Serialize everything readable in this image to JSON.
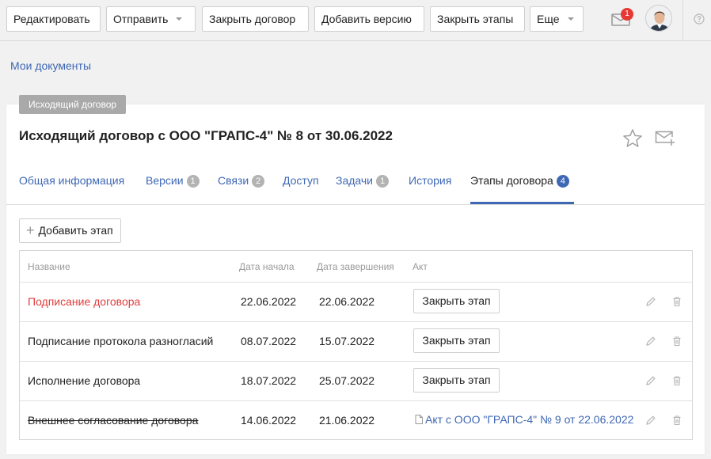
{
  "toolbar": {
    "edit_label": "Редактировать",
    "send_label": "Отправить",
    "close_contract_label": "Закрыть договор",
    "add_version_label": "Добавить версию",
    "close_stages_label": "Закрыть этапы",
    "more_label": "Еще",
    "notifications_count": "1"
  },
  "breadcrumb": {
    "label": "Мои документы"
  },
  "document": {
    "type_label": "Исходящий договор",
    "title": "Исходящий договор с ООО \"ГРАПС-4\" № 8 от 30.06.2022"
  },
  "tabs": [
    {
      "label": "Общая информация",
      "count": ""
    },
    {
      "label": "Версии",
      "count": "1"
    },
    {
      "label": "Связи",
      "count": "2"
    },
    {
      "label": "Доступ",
      "count": ""
    },
    {
      "label": "Задачи",
      "count": "1"
    },
    {
      "label": "История",
      "count": ""
    },
    {
      "label": "Этапы договора",
      "count": "4",
      "active": true
    }
  ],
  "stages": {
    "add_label": "Добавить этап",
    "columns": [
      "Название",
      "Дата начала",
      "Дата завершения",
      "Акт"
    ],
    "rows": [
      {
        "name": "Подписание договора",
        "start": "22.06.2022",
        "end": "22.06.2022",
        "act_button": "Закрыть этап",
        "status": "overdue"
      },
      {
        "name": "Подписание протокола разногласий",
        "start": "08.07.2022",
        "end": "15.07.2022",
        "act_button": "Закрыть этап",
        "status": "open"
      },
      {
        "name": "Исполнение договора",
        "start": "18.07.2022",
        "end": "25.07.2022",
        "act_button": "Закрыть этап",
        "status": "open"
      },
      {
        "name": "Внешнее согласование договора",
        "start": "14.06.2022",
        "end": "21.06.2022",
        "act_link": "Акт с ООО \"ГРАПС-4\" № 9 от 22.06.2022",
        "status": "closed"
      }
    ]
  },
  "colors": {
    "link": "#3f68b4",
    "overdue": "#e03c3c",
    "badge": "#e53935",
    "tab_badge": "#b3b3b3"
  },
  "icons": [
    "mail-icon",
    "avatar",
    "help-icon",
    "star-icon",
    "envelope-plus-icon",
    "plus-icon",
    "edit-pencil-icon",
    "trash-icon",
    "document-icon"
  ]
}
